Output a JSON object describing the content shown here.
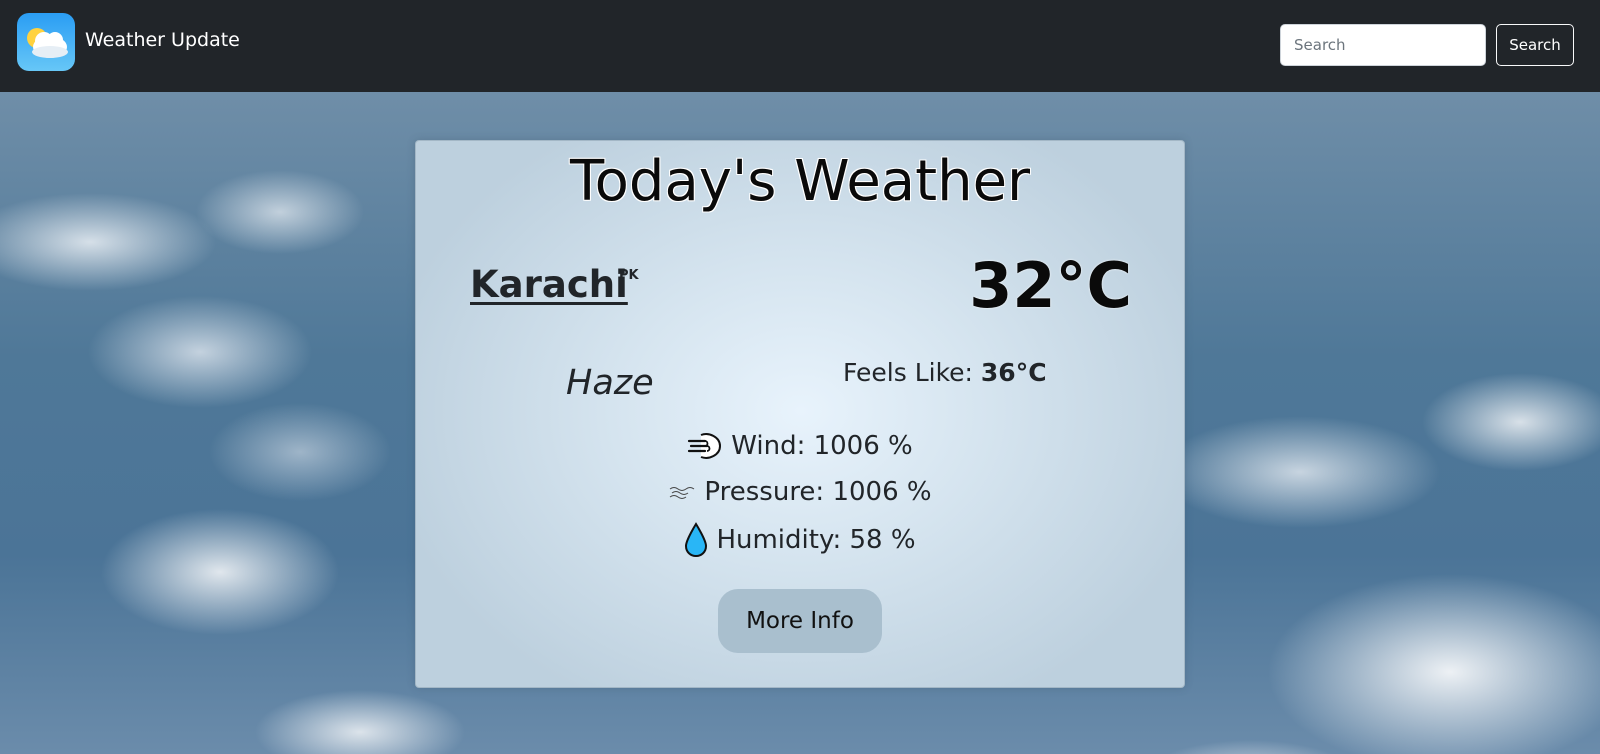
{
  "navbar": {
    "brand": "Weather Update",
    "search_placeholder": "Search",
    "search_button": "Search"
  },
  "weather": {
    "title": "Today's Weather",
    "city": "Karachi",
    "country": "PK",
    "temperature": "32°C",
    "condition": "Haze",
    "feels_like_label": "Feels Like: ",
    "feels_like_value": "36°C",
    "wind": "Wind: 1006 %",
    "pressure": "Pressure: 1006 %",
    "humidity": "Humidity: 58 %",
    "more_button": "More Info"
  },
  "colors": {
    "navbar_bg": "#212529",
    "button_bg": "#a9bfce",
    "humidity_icon": "#29b6f6"
  },
  "icons": {
    "logo": "sun-cloud-logo-icon",
    "wind": "wind-face-icon",
    "pressure": "pressure-lines-icon",
    "humidity": "water-drop-icon"
  }
}
